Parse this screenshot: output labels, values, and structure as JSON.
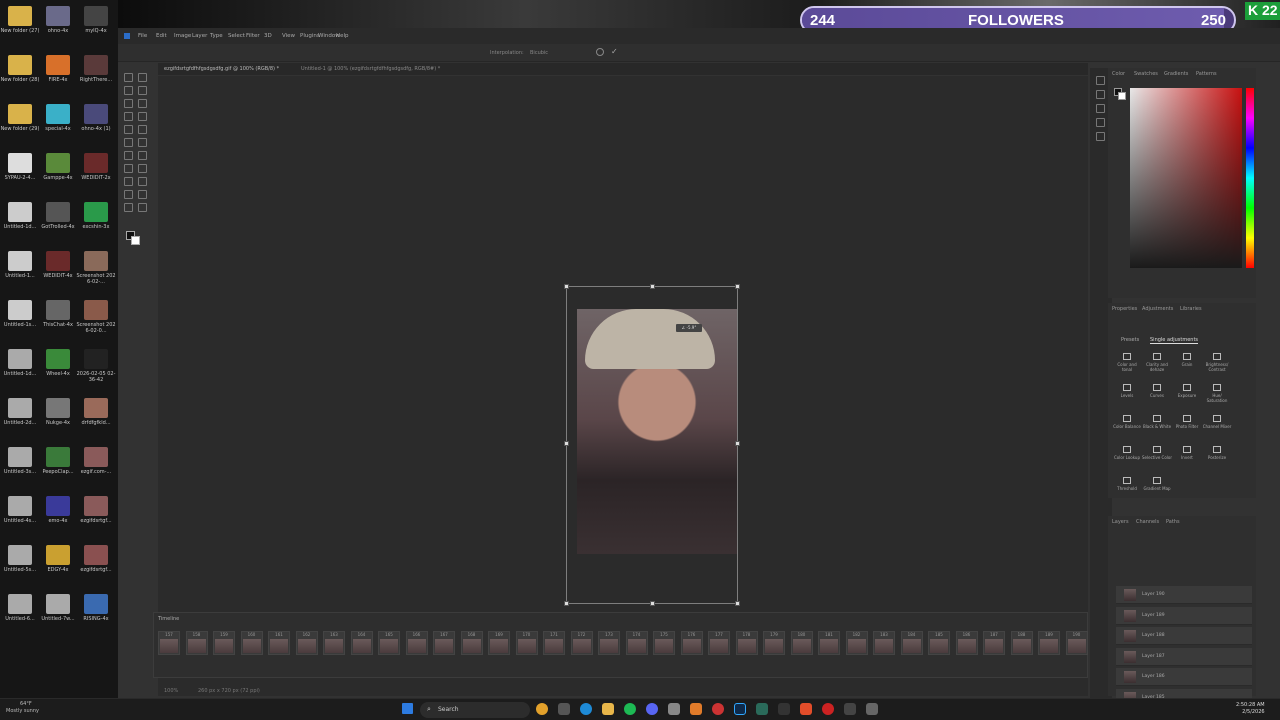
{
  "desktop": {
    "icons": [
      {
        "label": "New folder (27)",
        "color": "#d9b24a"
      },
      {
        "label": "ohno-4x",
        "color": "#6a6a8a"
      },
      {
        "label": "myIQ-4x",
        "color": "#444"
      },
      {
        "label": "New folder (28)",
        "color": "#d9b24a"
      },
      {
        "label": "FIRE-4x",
        "color": "#d8702a"
      },
      {
        "label": "RightThere...",
        "color": "#5a3a3a"
      },
      {
        "label": "New folder (29)",
        "color": "#d9b24a"
      },
      {
        "label": "special-4x",
        "color": "#3ab0c8"
      },
      {
        "label": "ohno-4x (1)",
        "color": "#4a4a7a"
      },
      {
        "label": "SYPAU-2-4...",
        "color": "#ddd"
      },
      {
        "label": "Gamppe-4x",
        "color": "#5a8a3a"
      },
      {
        "label": "WEDIDIT-2x",
        "color": "#6a2a2a"
      },
      {
        "label": "Untitled-1d...",
        "color": "#ccc"
      },
      {
        "label": "GotTrolled-4x",
        "color": "#555"
      },
      {
        "label": "excshin-3x",
        "color": "#2a9a4a"
      },
      {
        "label": "Untitled-1...",
        "color": "#ccc"
      },
      {
        "label": "WEDIDIT-4x",
        "color": "#6a2a2a"
      },
      {
        "label": "Screenshot 2026-02-...",
        "color": "#8a6a5a"
      },
      {
        "label": "Untitled-1s...",
        "color": "#ccc"
      },
      {
        "label": "ThisChat-4x",
        "color": "#666"
      },
      {
        "label": "Screenshot 2026-02-0...",
        "color": "#8a5a4a"
      },
      {
        "label": "Untitled-1d...",
        "color": "#aaa"
      },
      {
        "label": "Wheel-4x",
        "color": "#3a8a3a"
      },
      {
        "label": "2026-02-05 02-36-42",
        "color": "#222"
      },
      {
        "label": "Untitled-2d...",
        "color": "#aaa"
      },
      {
        "label": "Nukge-4x",
        "color": "#777"
      },
      {
        "label": "drfdfgfkld...",
        "color": "#9a6a5a"
      },
      {
        "label": "Untitled-3s...",
        "color": "#aaa"
      },
      {
        "label": "PeepoClap...",
        "color": "#3a7a3a"
      },
      {
        "label": "ezgif.com-...",
        "color": "#8a5a5a"
      },
      {
        "label": "Untitled-4s...",
        "color": "#aaa"
      },
      {
        "label": "emo-4x",
        "color": "#3a3a9a"
      },
      {
        "label": "ezgifdsrtgf...",
        "color": "#8a5a5a"
      },
      {
        "label": "Untitled-5s...",
        "color": "#aaa"
      },
      {
        "label": "EDGY-4x",
        "color": "#caa030"
      },
      {
        "label": "ezgifdsrtgf...",
        "color": "#8a5050"
      },
      {
        "label": "Untitled-6...",
        "color": "#aaa"
      },
      {
        "label": "Untitled-7w...",
        "color": "#aaa"
      },
      {
        "label": "RISING-4x",
        "color": "#3a6ab0"
      }
    ]
  },
  "stream": {
    "followers_current": "244",
    "followers_label": "FOLLOWERS",
    "followers_goal": "250",
    "followers_progress": 0.976,
    "corner_badge": "K 22"
  },
  "photoshop": {
    "menu": [
      "File",
      "Edit",
      "Image",
      "Layer",
      "Type",
      "Select",
      "Filter",
      "3D",
      "View",
      "Plugins",
      "Window",
      "Help"
    ],
    "options": {
      "interpolation_label": "Interpolation:",
      "interpolation_value": "Bicubic"
    },
    "tabs": [
      "ezgifdsrtgfdfhfgsdgsdfg.gif @ 100% (RGB/8) *",
      "Untitled-1 @ 100% (ezgifdsrtgfdfhfgsdgsdfg, RGB/8#) *"
    ],
    "transform_tooltip": "∠ -5.9°",
    "timeline": {
      "title": "Timeline",
      "frames": [
        "157",
        "158",
        "159",
        "160",
        "161",
        "162",
        "163",
        "164",
        "165",
        "166",
        "167",
        "168",
        "169",
        "170",
        "171",
        "172",
        "173",
        "174",
        "175",
        "176",
        "177",
        "178",
        "179",
        "180",
        "181",
        "182",
        "183",
        "184",
        "185",
        "186",
        "187",
        "188",
        "189",
        "190"
      ],
      "frame_delay": "0 s"
    },
    "status": {
      "zoom": "100%",
      "doc_info": "260 px x 720 px (72 ppi)"
    },
    "panels": {
      "color_tabs": [
        "Color",
        "Swatches",
        "Gradients",
        "Patterns"
      ],
      "adj_tabs": [
        "Properties",
        "Adjustments",
        "Libraries"
      ],
      "adj_subtabs": [
        "Presets",
        "Single adjustments"
      ],
      "adjustments": [
        "Color and tonal",
        "Clarity and dehaze",
        "Grain",
        "Brightness/ Contrast",
        "Levels",
        "Curves",
        "Exposure",
        "Hue/ Saturation",
        "Color Balance",
        "Black & White",
        "Photo Filter",
        "Channel Mixer",
        "Color Lookup",
        "Selective Color",
        "Invert",
        "Posterize",
        "Threshold",
        "Gradient Map"
      ],
      "layer_tabs": [
        "Layers",
        "Channels",
        "Paths"
      ],
      "layers": [
        "Layer 190",
        "Layer 189",
        "Layer 188",
        "Layer 187",
        "Layer 186",
        "Layer 185"
      ]
    }
  },
  "taskbar": {
    "weather_temp": "64°F",
    "weather_desc": "Mostly sunny",
    "search_label": "Search",
    "time": "2:50:28 AM",
    "date": "2/5/2026"
  }
}
